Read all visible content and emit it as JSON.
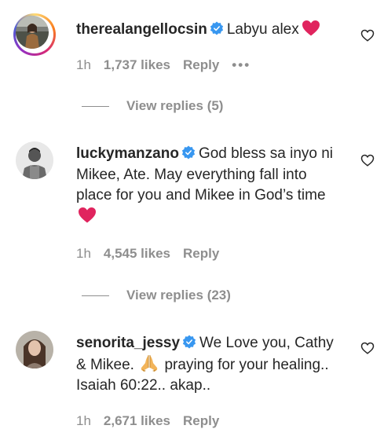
{
  "comments": [
    {
      "username": "therealangellocsin",
      "text": "Labyu alex",
      "time": "1h",
      "likes": "1,737 likes",
      "reply_label": "Reply",
      "more": "•••",
      "view_replies": "View replies (5)",
      "has_story_ring": true
    },
    {
      "username": "luckymanzano",
      "text": "God bless sa inyo ni Mikee, Ate. May everything fall into place for you and Mikee in God’s time",
      "time": "1h",
      "likes": "4,545 likes",
      "reply_label": "Reply",
      "view_replies": "View replies (23)",
      "has_story_ring": false
    },
    {
      "username": "senorita_jessy",
      "text_before": "We Love you, Cathy & Mikee.",
      "text_after": "praying for your healing.. Isaiah 60:22.. akap..",
      "time": "1h",
      "likes": "2,671 likes",
      "reply_label": "Reply",
      "has_story_ring": false
    }
  ],
  "colors": {
    "text": "#262626",
    "secondary": "#8e8e8e",
    "verified": "#3897f0",
    "heart_emoji": "#e0245e"
  },
  "icons": {
    "verified": "verified-badge-icon",
    "like": "heart-outline-icon",
    "heart_emoji": "red-heart-emoji",
    "pray_emoji": "folded-hands-emoji"
  }
}
